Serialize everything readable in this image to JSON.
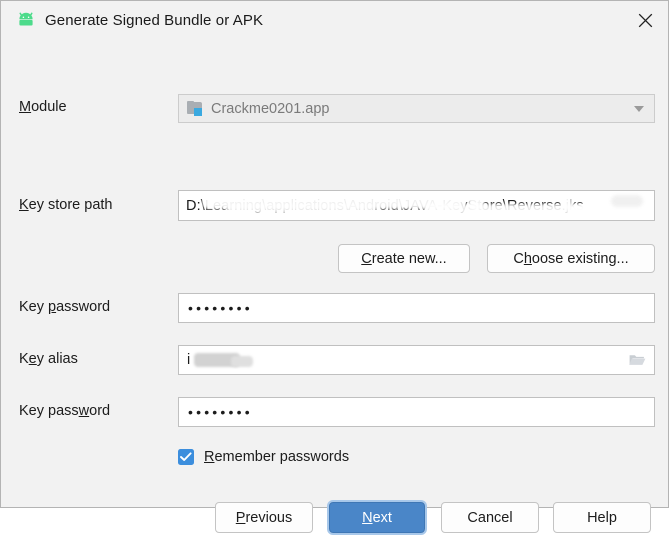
{
  "window": {
    "title": "Generate Signed Bundle or APK",
    "app_icon": "android-robot-icon",
    "close_icon": "close-icon",
    "accent_color": "#4a86c8",
    "android_green": "#4ddb8b",
    "background": "#f2f2f2"
  },
  "form": {
    "module": {
      "label_prefix": "",
      "label_accel": "M",
      "label_suffix": "odule",
      "icon": "module-folder-icon",
      "value": "Crackme0201.app",
      "dropdown_icon": "chevron-down-icon",
      "enabled": false
    },
    "keystore_path": {
      "label_accel": "K",
      "label_suffix": "ey store path",
      "value_visible_start": "D:\\",
      "value_visible_mid": "Learning\\applications\\Android\\JAVA-KeyStore\\",
      "value_visible_end": "Reverse.jks",
      "redacted": true,
      "placeholder": ""
    },
    "create_new_button": {
      "accel": "C",
      "suffix": "reate new..."
    },
    "choose_existing_button": {
      "prefix": "C",
      "accel": "h",
      "suffix": "oose existing..."
    },
    "keystore_password": {
      "label_prefix": "Key ",
      "label_accel": "p",
      "label_suffix": "assword",
      "value": "••••••••",
      "masked": true,
      "char_count": 8
    },
    "key_alias": {
      "label_prefix": "K",
      "label_accel": "e",
      "label_suffix": "y alias",
      "value": "i",
      "redacted": true,
      "browse_icon": "folder-open-icon"
    },
    "key_password": {
      "label_prefix": "Key pass",
      "label_accel": "w",
      "label_suffix": "ord",
      "value": "••••••••",
      "masked": true,
      "char_count": 8
    },
    "remember_passwords": {
      "accel": "R",
      "suffix": "emember passwords",
      "checked": true,
      "check_icon": "checkmark-icon"
    }
  },
  "footer": {
    "previous": {
      "accel": "P",
      "suffix": "revious"
    },
    "next": {
      "accel": "N",
      "suffix": "ext",
      "is_default": true
    },
    "cancel": {
      "label": "Cancel"
    },
    "help": {
      "label": "Help"
    }
  }
}
